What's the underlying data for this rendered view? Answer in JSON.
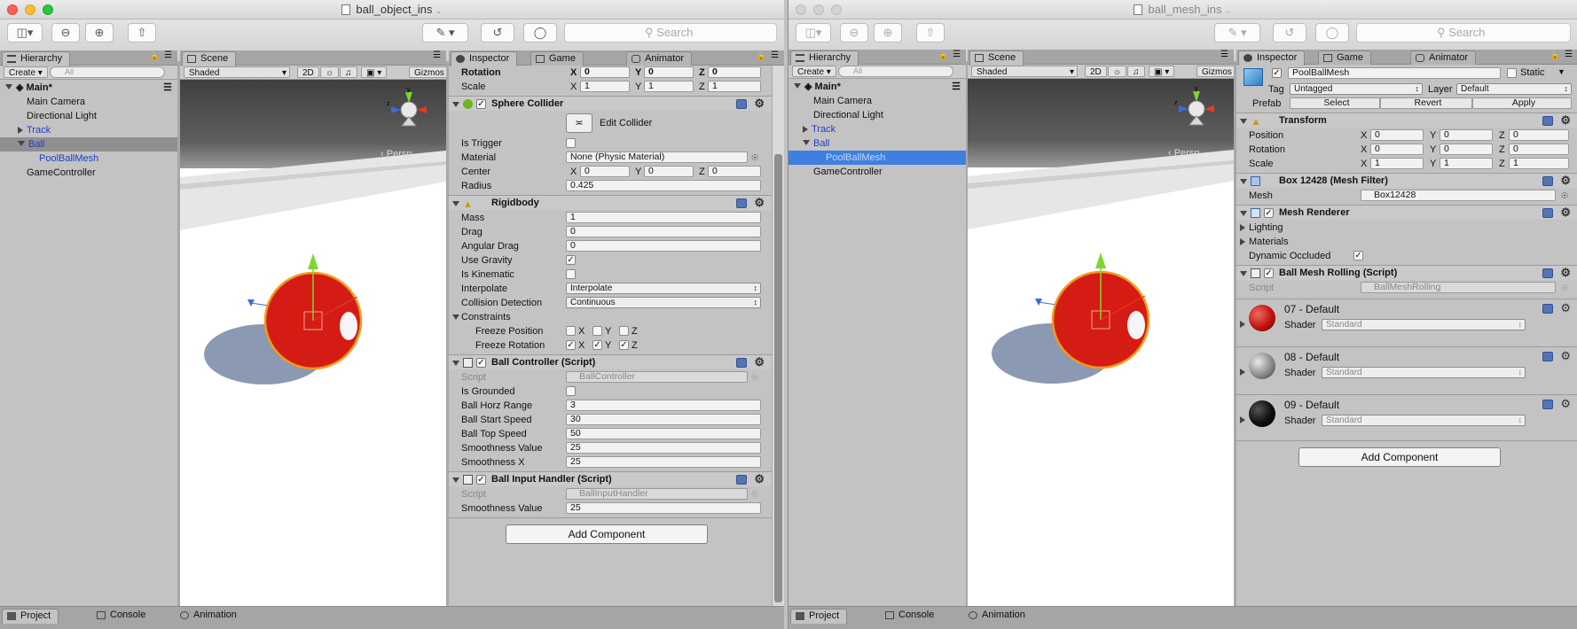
{
  "w1": {
    "title": "ball_object_ins",
    "search_placeholder": "Search",
    "hierarchy": {
      "tab": "Hierarchy",
      "create": "Create",
      "search": "All",
      "root": "Main*",
      "items": [
        {
          "label": "Main Camera"
        },
        {
          "label": "Directional Light"
        },
        {
          "label": "Track"
        },
        {
          "label": "Ball"
        },
        {
          "label": "PoolBallMesh"
        },
        {
          "label": "GameController"
        }
      ]
    },
    "scene": {
      "tab": "Scene",
      "mode": "Shaded",
      "mode2d": "2D",
      "gizmos": "Gizmos",
      "persp": "Persp"
    },
    "inspector": {
      "tabs": [
        "Inspector",
        "Game",
        "Animator"
      ],
      "rotation": {
        "label": "Rotation",
        "x": "0",
        "y": "0",
        "z": "0"
      },
      "scale": {
        "label": "Scale",
        "x": "1",
        "y": "1",
        "z": "1"
      },
      "sphere_collider": {
        "title": "Sphere Collider",
        "edit_collider": "Edit Collider",
        "is_trigger": "Is Trigger",
        "material_label": "Material",
        "material_value": "None (Physic Material)",
        "center_label": "Center",
        "center": {
          "x": "0",
          "y": "0",
          "z": "0"
        },
        "radius_label": "Radius",
        "radius": "0.425"
      },
      "rigidbody": {
        "title": "Rigidbody",
        "mass_label": "Mass",
        "mass": "1",
        "drag_label": "Drag",
        "drag": "0",
        "angular_drag_label": "Angular Drag",
        "angular_drag": "0",
        "use_gravity_label": "Use Gravity",
        "is_kinematic_label": "Is Kinematic",
        "interpolate_label": "Interpolate",
        "interpolate": "Interpolate",
        "collision_label": "Collision Detection",
        "collision": "Continuous",
        "constraints_label": "Constraints",
        "freeze_position_label": "Freeze Position",
        "freeze_rotation_label": "Freeze Rotation",
        "axes": [
          "X",
          "Y",
          "Z"
        ]
      },
      "ball_controller": {
        "title": "Ball Controller (Script)",
        "script_label": "Script",
        "script": "BallController",
        "is_grounded_label": "Is Grounded",
        "horz_range_label": "Ball Horz Range",
        "horz_range": "3",
        "start_speed_label": "Ball Start Speed",
        "start_speed": "30",
        "top_speed_label": "Ball Top Speed",
        "top_speed": "50",
        "smooth_value_label": "Smoothness Value",
        "smooth_value": "25",
        "smooth_x_label": "Smoothness X",
        "smooth_x": "25"
      },
      "ball_input": {
        "title": "Ball Input Handler (Script)",
        "script_label": "Script",
        "script": "BallInputHandler",
        "smooth_value_label": "Smoothness Value",
        "smooth_value": "25"
      },
      "add_component": "Add Component"
    },
    "bottom_tabs": [
      "Project",
      "Console",
      "Animation"
    ]
  },
  "w2": {
    "title": "ball_mesh_ins",
    "search_placeholder": "Search",
    "hierarchy": {
      "tab": "Hierarchy",
      "create": "Create",
      "search": "All",
      "root": "Main*",
      "items": [
        {
          "label": "Main Camera"
        },
        {
          "label": "Directional Light"
        },
        {
          "label": "Track"
        },
        {
          "label": "Ball"
        },
        {
          "label": "PoolBallMesh"
        },
        {
          "label": "GameController"
        }
      ]
    },
    "scene": {
      "tab": "Scene",
      "mode": "Shaded",
      "mode2d": "2D",
      "gizmos": "Gizmos",
      "persp": "Persp"
    },
    "inspector": {
      "tabs": [
        "Inspector",
        "Game",
        "Animator"
      ],
      "object_name": "PoolBallMesh",
      "static_label": "Static",
      "tag_label": "Tag",
      "tag": "Untagged",
      "layer_label": "Layer",
      "layer": "Default",
      "prefab_label": "Prefab",
      "prefab_buttons": [
        "Select",
        "Revert",
        "Apply"
      ],
      "transform": {
        "title": "Transform",
        "position": {
          "label": "Position",
          "x": "0",
          "y": "0",
          "z": "0"
        },
        "rotation": {
          "label": "Rotation",
          "x": "0",
          "y": "0",
          "z": "0"
        },
        "scale": {
          "label": "Scale",
          "x": "1",
          "y": "1",
          "z": "1"
        }
      },
      "mesh_filter": {
        "title": "Box 12428 (Mesh Filter)",
        "mesh_label": "Mesh",
        "mesh": "Box12428"
      },
      "mesh_renderer": {
        "title": "Mesh Renderer",
        "lighting": "Lighting",
        "materials": "Materials",
        "dynamic_occluded": "Dynamic Occluded"
      },
      "mesh_rolling": {
        "title": "Ball Mesh Rolling (Script)",
        "script_label": "Script",
        "script": "BallMeshRolling"
      },
      "materials": [
        {
          "name": "07 - Default",
          "shader_label": "Shader",
          "shader": "Standard",
          "color": "#c0140f"
        },
        {
          "name": "08 - Default",
          "shader_label": "Shader",
          "shader": "Standard",
          "color": "#8c8c8c"
        },
        {
          "name": "09 - Default",
          "shader_label": "Shader",
          "shader": "Standard",
          "color": "#0d0d0d"
        }
      ],
      "add_component": "Add Component"
    },
    "bottom_tabs": [
      "Project",
      "Console",
      "Animation"
    ]
  },
  "colors": {
    "selection_blue": "#3f7fe0",
    "ball_red": "#d41c14",
    "gizmo_green": "#7fd62d",
    "gizmo_blue": "#3a6cd8"
  }
}
